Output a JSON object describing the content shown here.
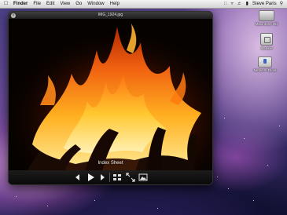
{
  "menubar": {
    "app_name": "Finder",
    "items": [
      "File",
      "Edit",
      "View",
      "Go",
      "Window",
      "Help"
    ],
    "user_name": "Steve Paris"
  },
  "desktop_icons": [
    {
      "label": "Macintosh HD",
      "icon": "hard-drive-icon"
    },
    {
      "label": "Steeker",
      "icon": "usb-drive-icon"
    },
    {
      "label": "Network Drive",
      "icon": "network-drive-icon"
    }
  ],
  "quicklook": {
    "title": "IMG_1924.jpg",
    "caption": "Index Sheet",
    "controls": [
      {
        "name": "previous-icon"
      },
      {
        "name": "play-icon"
      },
      {
        "name": "next-icon"
      },
      {
        "name": "index-sheet-icon"
      },
      {
        "name": "fullscreen-icon"
      },
      {
        "name": "add-to-iphoto-icon"
      }
    ]
  },
  "colors": {
    "menubar_bg": "#e6e6e6",
    "window_bg": "#000000",
    "flame_bright": "#ffd23a",
    "flame_mid": "#ff7a10",
    "flame_dark": "#b83200"
  }
}
